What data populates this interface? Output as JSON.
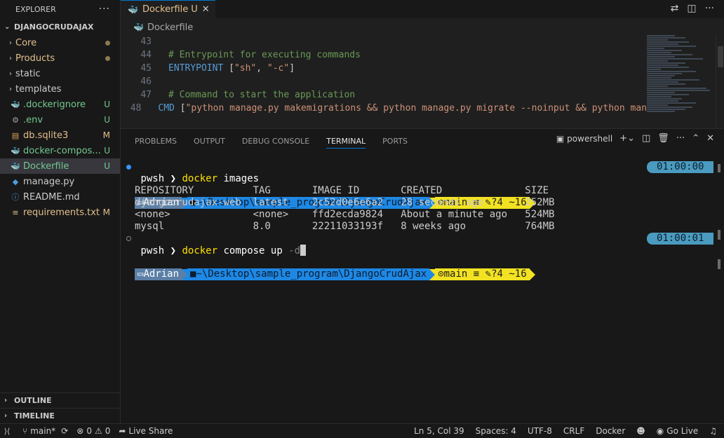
{
  "explorer": {
    "title": "EXPLORER",
    "more": "···",
    "project": "DJANGOCRUDAJAX",
    "items": [
      {
        "label": "Core",
        "type": "folder",
        "badge": "dot"
      },
      {
        "label": "Products",
        "type": "folder",
        "badge": "dot"
      },
      {
        "label": "static",
        "type": "folder",
        "badge": ""
      },
      {
        "label": "templates",
        "type": "folder",
        "badge": ""
      },
      {
        "label": ".dockerignore",
        "type": "file",
        "icon": "whale-icon",
        "badge": "U"
      },
      {
        "label": ".env",
        "type": "file",
        "icon": "gear-icon",
        "badge": "U"
      },
      {
        "label": "db.sqlite3",
        "type": "file",
        "icon": "database-icon",
        "badge": "M"
      },
      {
        "label": "docker-compos...",
        "type": "file",
        "icon": "compose-icon",
        "badge": "U"
      },
      {
        "label": "Dockerfile",
        "type": "file",
        "icon": "whale-icon",
        "badge": "U"
      },
      {
        "label": "manage.py",
        "type": "file",
        "icon": "python-icon",
        "badge": ""
      },
      {
        "label": "README.md",
        "type": "file",
        "icon": "info-icon",
        "badge": ""
      },
      {
        "label": "requirements.txt",
        "type": "file",
        "icon": "list-icon",
        "badge": "M"
      }
    ],
    "outline": "OUTLINE",
    "timeline": "TIMELINE"
  },
  "tab": {
    "label": "Dockerfile",
    "status": "U",
    "close": "✕"
  },
  "breadcrumb": "Dockerfile",
  "code": {
    "lines": [
      {
        "num": "43",
        "parts": []
      },
      {
        "num": "44",
        "parts": [
          {
            "c": "cmt",
            "t": "# Entrypoint for executing commands"
          }
        ]
      },
      {
        "num": "45",
        "parts": [
          {
            "c": "kw",
            "t": "ENTRYPOINT"
          },
          {
            "c": "pun",
            "t": " ["
          },
          {
            "c": "str",
            "t": "\"sh\""
          },
          {
            "c": "pun",
            "t": ", "
          },
          {
            "c": "str",
            "t": "\"-c\""
          },
          {
            "c": "pun",
            "t": "]"
          }
        ]
      },
      {
        "num": "46",
        "parts": []
      },
      {
        "num": "47",
        "parts": [
          {
            "c": "cmt",
            "t": "# Command to start the application"
          }
        ]
      },
      {
        "num": "48",
        "parts": [
          {
            "c": "kw",
            "t": "CMD"
          },
          {
            "c": "pun",
            "t": " ["
          },
          {
            "c": "str",
            "t": "\"python manage.py makemigrations && python manage.py migrate --noinput && python man"
          }
        ]
      }
    ]
  },
  "panel": {
    "tabs": [
      "PROBLEMS",
      "OUTPUT",
      "DEBUG CONSOLE",
      "TERMINAL",
      "PORTS"
    ],
    "active_tab": "TERMINAL",
    "shell": "powershell"
  },
  "terminal": {
    "prompt_user": "Adrian",
    "prompt_path": "~\\Desktop\\sample_program\\DjangoCrudAjax",
    "prompt_git": "main ≡ ",
    "prompt_changes": "?4 ~16",
    "time1": "01:00:00",
    "time2": "01:00:01",
    "shell_label": "pwsh",
    "chev": "❯",
    "cmd1_name": "docker",
    "cmd1_rest": " images",
    "cmd2_name": "docker",
    "cmd2_rest": " compose up ",
    "cmd2_flag": "-d",
    "table_header": "REPOSITORY          TAG       IMAGE ID       CREATED              SIZE",
    "rows": [
      "djangocrudajax-web  latest    2c52d0e6e6a2   28 seconds ago       252MB",
      "<none>              <none>    ffd2ecda9824   About a minute ago   524MB",
      "mysql               8.0       22211033193f   8 weeks ago          764MB"
    ]
  },
  "status": {
    "branch": "main*",
    "errors": "0",
    "warnings": "0",
    "live_share": "Live Share",
    "position": "Ln 5, Col 39",
    "spaces": "Spaces: 4",
    "encoding": "UTF-8",
    "eol": "CRLF",
    "language": "Docker",
    "go_live": "Go Live"
  }
}
